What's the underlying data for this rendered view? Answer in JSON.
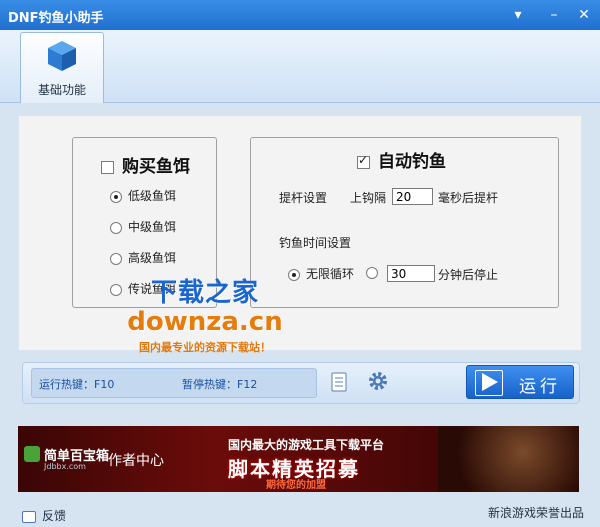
{
  "window": {
    "title": "DNF钓鱼小助手",
    "menu_icon": "chevron-down-icon",
    "minimize_icon": "minimize-icon",
    "close_icon": "close-icon"
  },
  "toolbar": {
    "tab_label": "基础功能",
    "tab_icon": "cube-icon"
  },
  "buy_bait": {
    "title": "购买鱼饵",
    "checked": false,
    "options": [
      "低级鱼饵",
      "中级鱼饵",
      "高级鱼饵",
      "传说鱼饵"
    ],
    "selected": "低级鱼饵"
  },
  "auto_fish": {
    "title": "自动钓鱼",
    "checked": true,
    "lift_label": "提杆设置",
    "lift_prefix": "上钩隔",
    "lift_value": "20",
    "lift_suffix": "毫秒后提杆",
    "time_label": "钓鱼时间设置",
    "loop_label": "无限循环",
    "loop_selected": true,
    "stop_value": "30",
    "stop_suffix": "分钟后停止"
  },
  "watermark": {
    "line1": "下载之家",
    "line2": "downza.cn",
    "line3": "国内最专业的资源下载站！"
  },
  "run_bar": {
    "run_hotkey": "运行热键：F10",
    "pause_hotkey": "暂停热键：F12",
    "run_label": "运行",
    "log_icon": "document-icon",
    "settings_icon": "gear-icon"
  },
  "banner": {
    "logo": "简单百宝箱",
    "logo_sub": "Jdbbx.com",
    "author": "作者中心",
    "top": "国内最大的游戏工具下载平台",
    "main": "脚本精英招募",
    "sub": "期待您的加盟"
  },
  "footer": {
    "feedback": "反馈",
    "credit": "新浪游戏荣誉出品"
  },
  "colors": {
    "titlebar": "#1f6fd0",
    "accent": "#1762c9",
    "background": "#d6e4f2"
  }
}
